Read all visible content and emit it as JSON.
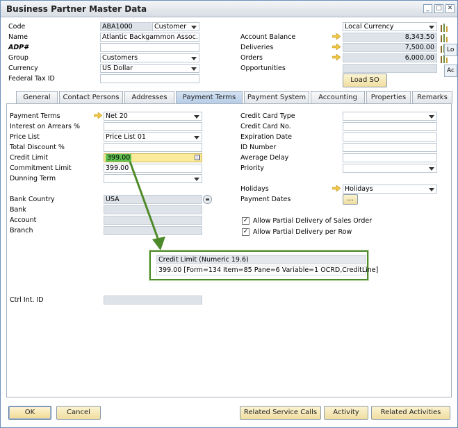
{
  "window": {
    "title": "Business Partner Master Data"
  },
  "header": {
    "code_label": "Code",
    "code_value": "ABA1000",
    "type_value": "Customer",
    "name_label": "Name",
    "name_value": "Atlantic Backgammon Assoc.",
    "adp_label": "ADP#",
    "adp_value": "",
    "group_label": "Group",
    "group_value": "Customers",
    "currency_label": "Currency",
    "currency_value": "US Dollar",
    "taxid_label": "Federal Tax ID",
    "taxid_value": "",
    "currency_mode": "Local Currency",
    "balance_label": "Account Balance",
    "balance_value": "8,343.50",
    "deliveries_label": "Deliveries",
    "deliveries_value": "7,500.00",
    "orders_label": "Orders",
    "orders_value": "6,000.00",
    "opps_label": "Opportunities",
    "opps_value": "",
    "load_so": "Load SO",
    "side_lo": "Lo",
    "side_ac": "Ac"
  },
  "tabs": [
    "General",
    "Contact Persons",
    "Addresses",
    "Payment Terms",
    "Payment System",
    "Accounting",
    "Properties",
    "Remarks"
  ],
  "left": {
    "payment_terms_label": "Payment Terms",
    "payment_terms_value": "Net 20",
    "arrears_label": "Interest on Arrears %",
    "arrears_value": "",
    "pricelist_label": "Price List",
    "pricelist_value": "Price List 01",
    "discount_label": "Total Discount %",
    "discount_value": "",
    "credit_limit_label": "Credit Limit",
    "credit_limit_value": "399.00",
    "commitment_label": "Commitment Limit",
    "commitment_value": "399.00",
    "dunning_label": "Dunning Term",
    "dunning_value": "",
    "bank_country_label": "Bank Country",
    "bank_country_value": "USA",
    "bank_label": "Bank",
    "bank_value": "",
    "account_label": "Account",
    "account_value": "",
    "branch_label": "Branch",
    "branch_value": "",
    "ctrl_label": "Ctrl Int. ID",
    "ctrl_value": ""
  },
  "right": {
    "cc_type_label": "Credit Card Type",
    "cc_type_value": "",
    "cc_no_label": "Credit Card  No.",
    "cc_no_value": "",
    "exp_label": "Expiration Date",
    "exp_value": "",
    "id_label": "ID Number",
    "id_value": "",
    "avg_label": "Average Delay",
    "avg_value": "",
    "priority_label": "Priority",
    "priority_value": "",
    "holidays_label": "Holidays",
    "holidays_value": "Holidays",
    "paydates_label": "Payment Dates",
    "paydates_btn": "...",
    "partial_order_label": "Allow Partial Delivery of Sales Order",
    "partial_order_checked": true,
    "partial_row_label": "Allow Partial Delivery per Row",
    "partial_row_checked": true
  },
  "tooltip": {
    "header": "Credit Limit (Numeric 19.6)",
    "body": "399.00 [Form=134 Item=85 Pane=6 Variable=1 OCRD,CreditLine]"
  },
  "footer": {
    "ok": "OK",
    "cancel": "Cancel",
    "service_calls": "Related Service Calls",
    "activity": "Activity",
    "activities": "Related Activities"
  },
  "colors": {
    "accent": "#4d8a2a",
    "arrow": "#f2c744",
    "highlight": "#fbeb9a"
  }
}
